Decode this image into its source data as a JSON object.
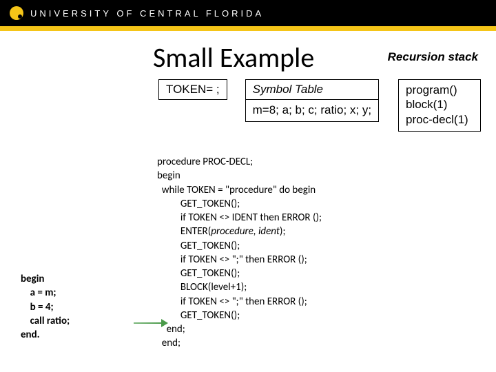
{
  "header": {
    "university": "UNIVERSITY OF CENTRAL FLORIDA"
  },
  "title": "Small Example",
  "recursion_label": "Recursion stack",
  "token_box": "TOKEN= ;",
  "symbol_table": {
    "header": "Symbol Table",
    "body": "m=8; a; b; c;\nratio; x; y;"
  },
  "recursion_stack": "program()\nblock(1)\nproc-decl(1)",
  "code_left": "begin\n    a = m;\n    b = 4;\n    call ratio;\nend.",
  "code_main_pre": "procedure PROC-DECL;\nbegin\n  while TOKEN = \"procedure\" do begin\n          GET_TOKEN();\n          if TOKEN <> IDENT then ERROR ();\n          ENTER(",
  "code_main_ital": "procedure, ident",
  "code_main_post": ");\n          GET_TOKEN();\n          if TOKEN <> \";\" then ERROR ();\n          GET_TOKEN();\n          BLOCK(level+1);\n          if TOKEN <> \";\" then ERROR ();\n          GET_TOKEN();\n    end;\n  end;"
}
